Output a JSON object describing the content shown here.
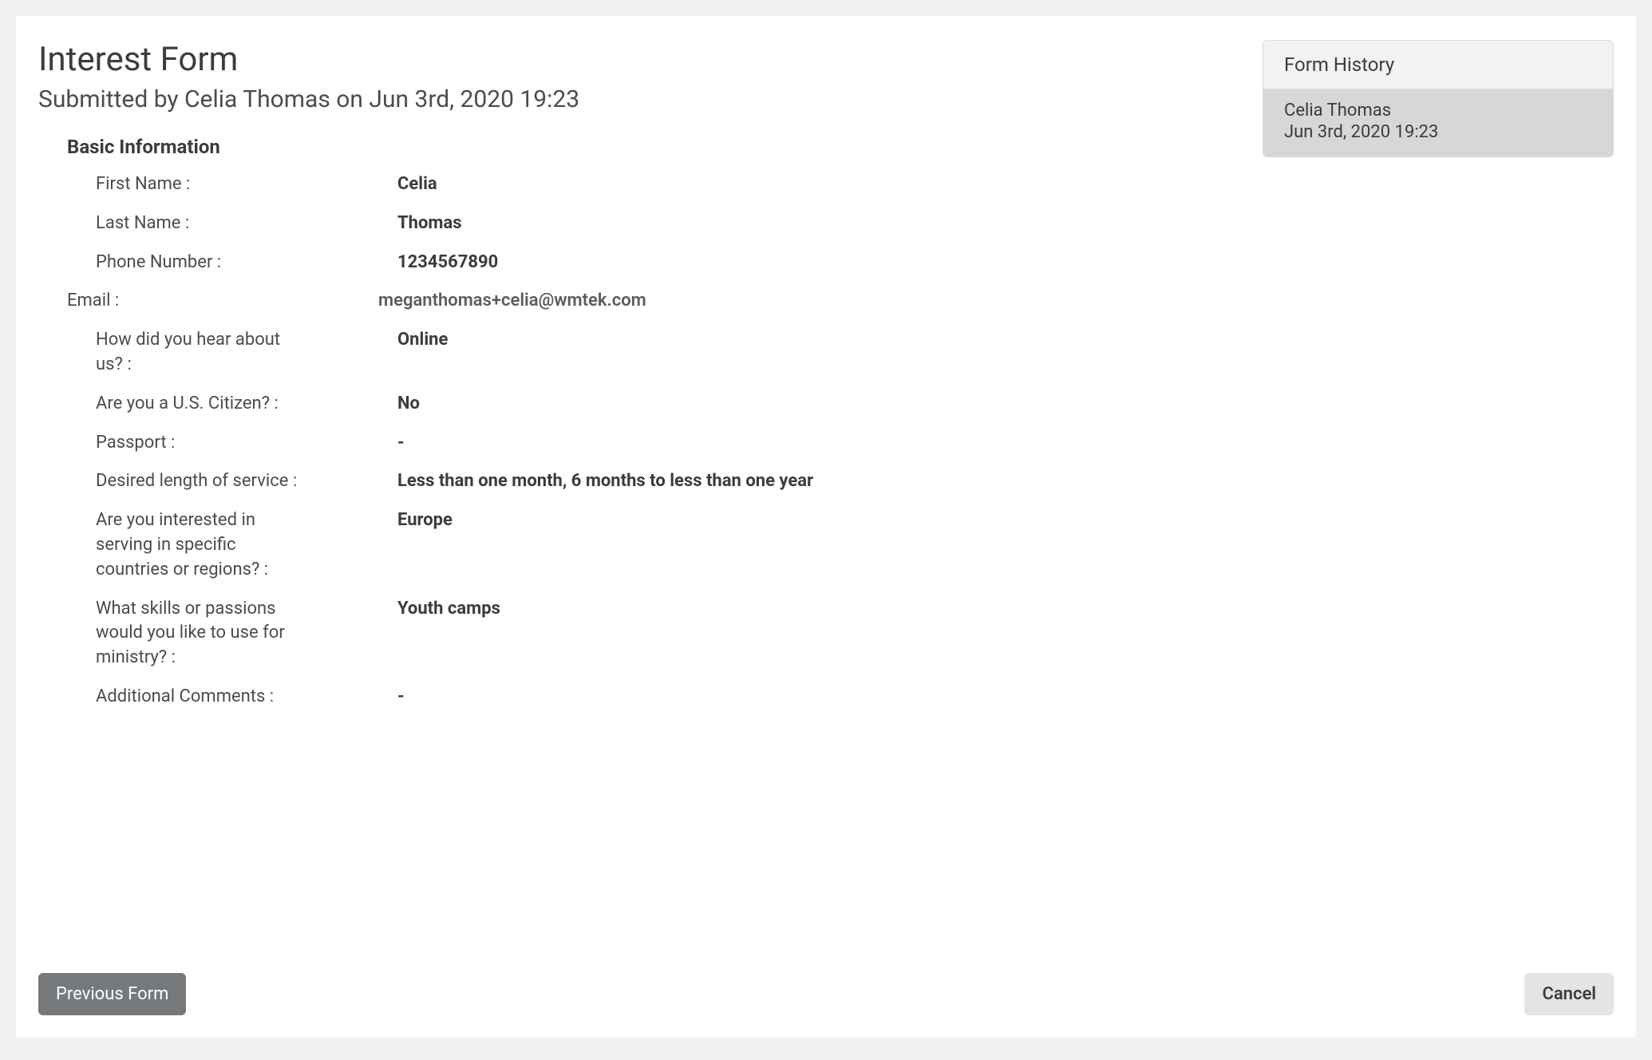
{
  "header": {
    "title": "Interest Form",
    "subtitle": "Submitted by Celia Thomas on Jun 3rd, 2020 19:23"
  },
  "form": {
    "section_title": "Basic Information",
    "fields": [
      {
        "label": "First Name :",
        "value": "Celia",
        "bold": true,
        "outdent": false
      },
      {
        "label": "Last Name :",
        "value": "Thomas",
        "bold": true,
        "outdent": false
      },
      {
        "label": "Phone Number :",
        "value": "1234567890",
        "bold": true,
        "outdent": false
      },
      {
        "label": "Email :",
        "value": "meganthomas+celia@wmtek.com",
        "bold": false,
        "outdent": true,
        "email": true
      },
      {
        "label": "How did you hear about us? :",
        "value": "Online",
        "bold": true,
        "outdent": false
      },
      {
        "label": "Are you a U.S. Citizen? :",
        "value": "No",
        "bold": true,
        "outdent": false
      },
      {
        "label": "Passport :",
        "value": "-",
        "bold": true,
        "outdent": false
      },
      {
        "label": "Desired length of service :",
        "value": "Less than one month, 6 months to less than one year",
        "bold": true,
        "outdent": false
      },
      {
        "label": "Are you interested in serving in specific countries or regions? :",
        "value": "Europe",
        "bold": true,
        "outdent": false
      },
      {
        "label": "What skills or passions would you like to use for ministry? :",
        "value": "Youth camps",
        "bold": true,
        "outdent": false
      },
      {
        "label": "Additional Comments :",
        "value": "-",
        "bold": true,
        "outdent": false
      }
    ]
  },
  "buttons": {
    "previous_label": "Previous Form",
    "cancel_label": "Cancel"
  },
  "history": {
    "header": "Form History",
    "items": [
      {
        "name": "Celia Thomas",
        "date": "Jun 3rd, 2020 19:23"
      }
    ]
  }
}
